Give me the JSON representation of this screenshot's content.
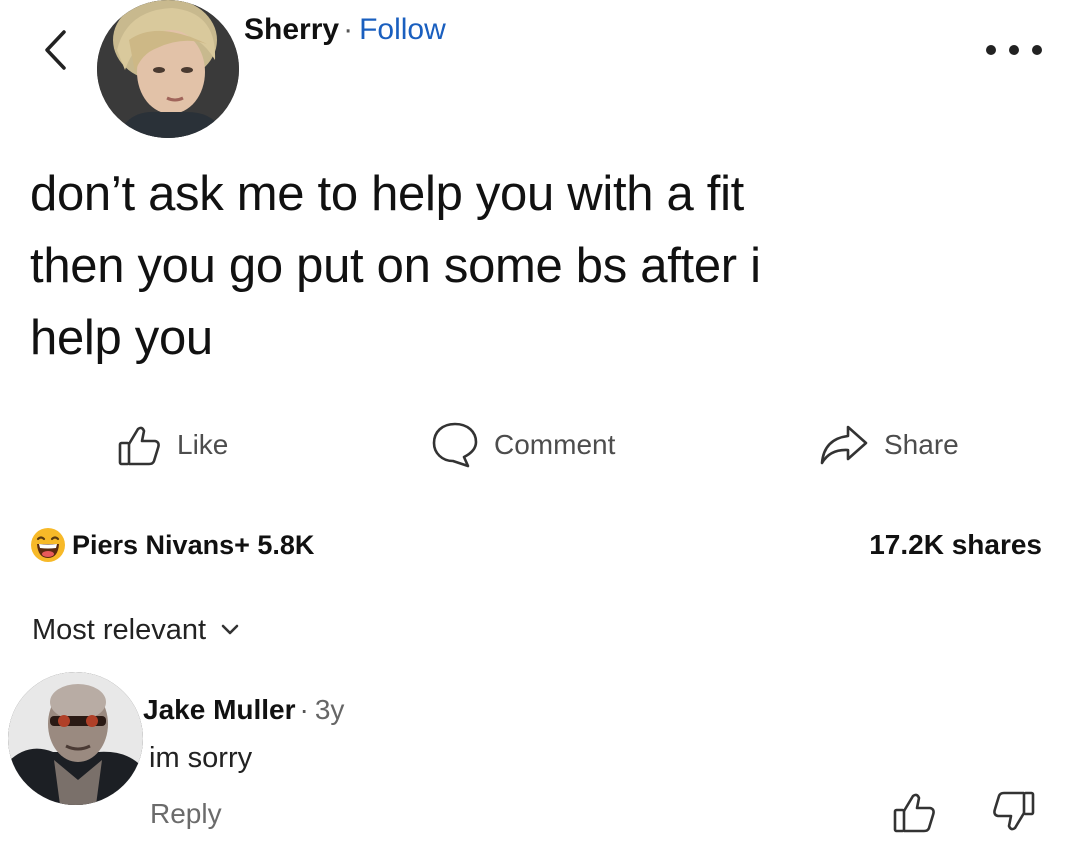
{
  "header": {
    "poster_name": "Sherry",
    "separator": "·",
    "follow_label": "Follow"
  },
  "post": {
    "lines": [
      "don’t ask me to help you with a fit",
      "then you go put on some bs after i",
      "help you"
    ]
  },
  "actions": {
    "like_label": "Like",
    "comment_label": "Comment",
    "share_label": "Share"
  },
  "stats": {
    "reactions_text": "Piers Nivans+ 5.8K",
    "shares_text": "17.2K shares"
  },
  "sort": {
    "label": "Most relevant"
  },
  "comment": {
    "author": "Jake Muller",
    "separator": "·",
    "time": "3y",
    "text": "im sorry",
    "reply_label": "Reply"
  },
  "icons": {
    "back": "chevron-left-icon",
    "more": "more-horizontal-icon",
    "like": "thumbs-up-icon",
    "comment": "speech-bubble-icon",
    "share": "share-arrow-icon",
    "reaction": "laughing-emoji-icon",
    "sort": "chevron-down-icon",
    "upvote": "thumbs-up-icon",
    "downvote": "thumbs-down-icon"
  },
  "colors": {
    "follow": "#1a5fbf",
    "text": "#111111",
    "muted": "#6b6b6b",
    "emoji": "#f7b928"
  }
}
